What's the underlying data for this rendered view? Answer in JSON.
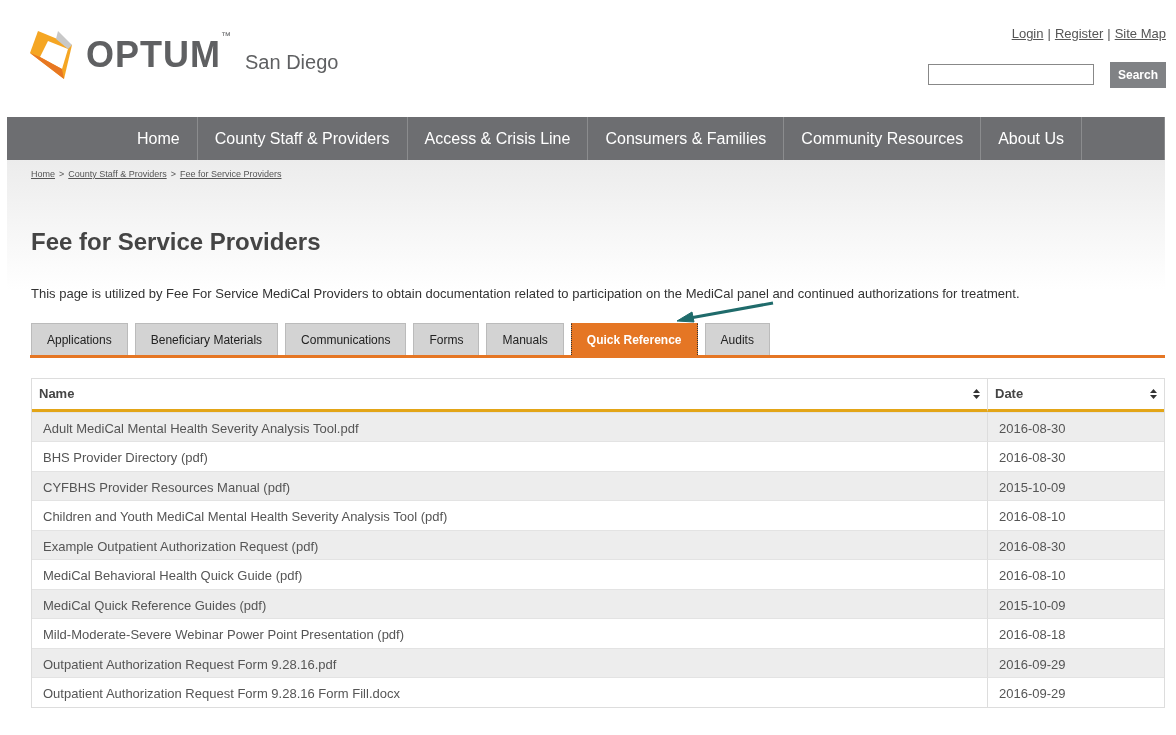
{
  "header": {
    "logo_text": "OPTUM",
    "trademark": "™",
    "site_name": "San Diego",
    "top_links": [
      "Login",
      "Register",
      "Site Map"
    ],
    "link_separator": "|",
    "search_button": "Search"
  },
  "nav": [
    "Home",
    "County Staff & Providers",
    "Access & Crisis Line",
    "Consumers & Families",
    "Community Resources",
    "About Us"
  ],
  "breadcrumb": {
    "items": [
      "Home",
      "County Staff & Providers",
      "Fee for Service Providers"
    ],
    "separator": ">"
  },
  "page": {
    "title": "Fee for Service Providers",
    "intro": "This page is utilized by Fee For Service MediCal Providers to obtain documentation related to participation on the MediCal panel and continued authorizations for treatment."
  },
  "tabs": [
    {
      "label": "Applications",
      "selected": false
    },
    {
      "label": "Beneficiary Materials",
      "selected": false
    },
    {
      "label": "Communications",
      "selected": false
    },
    {
      "label": "Forms",
      "selected": false
    },
    {
      "label": "Manuals",
      "selected": false
    },
    {
      "label": "Quick Reference",
      "selected": true
    },
    {
      "label": "Audits",
      "selected": false
    }
  ],
  "table": {
    "columns": [
      "Name",
      "Date"
    ],
    "rows": [
      [
        "Adult MediCal Mental Health Severity Analysis Tool.pdf",
        "2016-08-30"
      ],
      [
        "BHS Provider Directory (pdf)",
        "2016-08-30"
      ],
      [
        "CYFBHS Provider Resources Manual (pdf)",
        "2015-10-09"
      ],
      [
        "Children and Youth MediCal Mental Health Severity Analysis Tool (pdf)",
        "2016-08-10"
      ],
      [
        "Example Outpatient Authorization Request (pdf)",
        "2016-08-30"
      ],
      [
        "MediCal Behavioral Health Quick Guide (pdf)",
        "2016-08-10"
      ],
      [
        "MediCal Quick Reference Guides (pdf)",
        "2015-10-09"
      ],
      [
        "Mild-Moderate-Severe Webinar Power Point Presentation (pdf)",
        "2016-08-18"
      ],
      [
        "Outpatient Authorization Request Form 9.28.16.pdf",
        "2016-09-29"
      ],
      [
        "Outpatient Authorization Request Form 9.28.16 Form Fill.docx",
        "2016-09-29"
      ]
    ]
  }
}
